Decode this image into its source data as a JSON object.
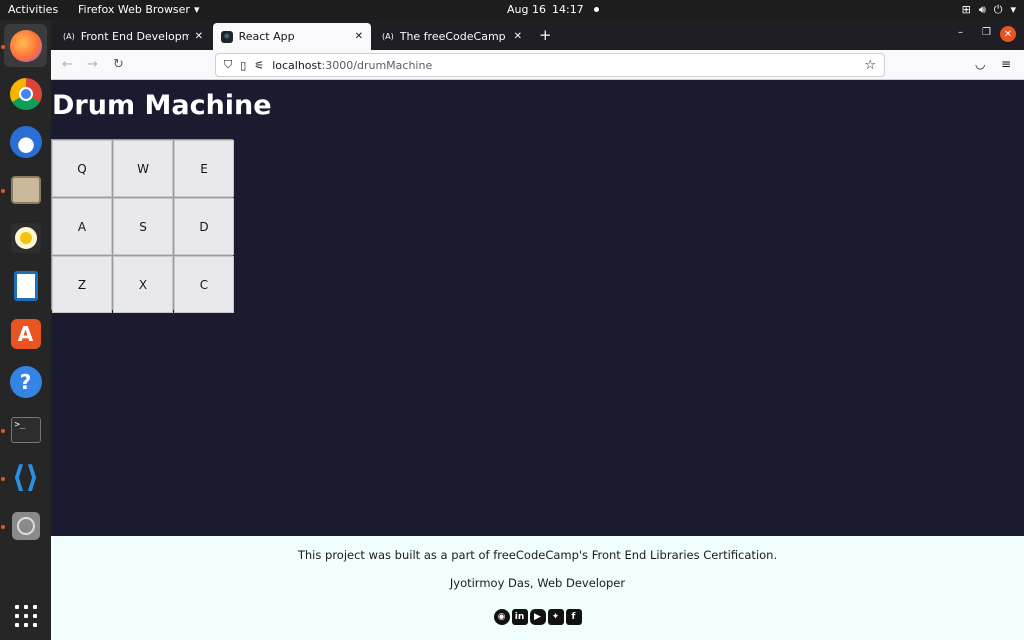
{
  "topbar": {
    "activities": "Activities",
    "app_menu": "Firefox Web Browser",
    "date": "Aug 16",
    "time": "14:17"
  },
  "dock": {
    "items": [
      "firefox-icon",
      "chrome-icon",
      "thunderbird-icon",
      "files-icon",
      "rhythmbox-icon",
      "writer-icon",
      "software-icon",
      "help-icon",
      "terminal-icon",
      "vscode-icon",
      "disc-icon",
      "app-grid-icon"
    ]
  },
  "browser": {
    "tabs": [
      {
        "label": "Front End Development L",
        "active": false
      },
      {
        "label": "React App",
        "active": true
      },
      {
        "label": "The freeCodeCamp Forum",
        "active": false
      }
    ],
    "url_host": "localhost",
    "url_path": ":3000/drumMachine"
  },
  "page": {
    "title": "Drum Machine",
    "pads": [
      "Q",
      "W",
      "E",
      "A",
      "S",
      "D",
      "Z",
      "X",
      "C"
    ]
  },
  "footer": {
    "line1": "This project was built as a part of freeCodeCamp's Front End Libraries Certification.",
    "line2": "Jyotirmoy Das, Web Developer",
    "social": [
      "github-icon",
      "linkedin-icon",
      "youtube-icon",
      "twitter-icon",
      "facebook-icon"
    ]
  },
  "colors": {
    "page_bg": "#1b1b2f",
    "footer_bg": "#f0fffe",
    "accent": "#e95420"
  }
}
